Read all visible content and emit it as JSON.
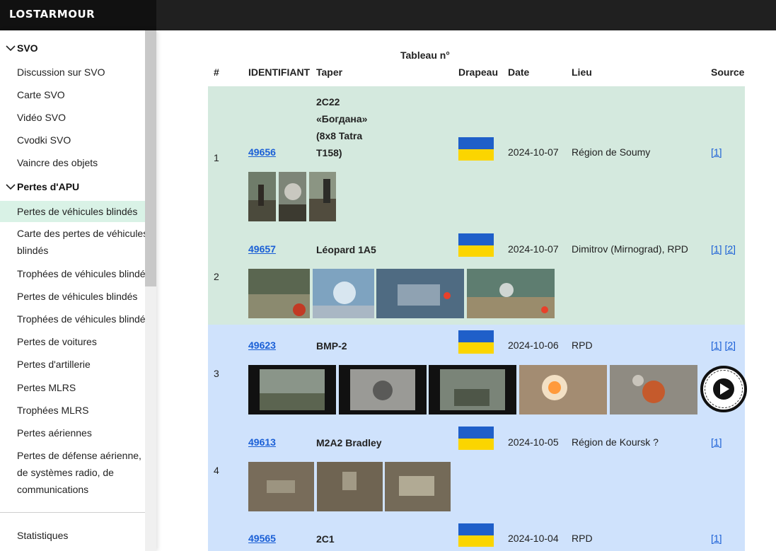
{
  "app": {
    "logo": "LOSTARMOUR"
  },
  "sidebar": {
    "groups": [
      {
        "label": "SVO"
      },
      {
        "label": "Pertes d'APU"
      }
    ],
    "svo_items": [
      {
        "label": "Discussion sur SVO"
      },
      {
        "label": "Carte SVO"
      },
      {
        "label": "Vidéo SVO"
      },
      {
        "label": "Cvodki SVO"
      },
      {
        "label": "Vaincre des objets"
      }
    ],
    "apu_items": [
      {
        "label": "Pertes de véhicules blindés",
        "active": true
      },
      {
        "label": "Carte des pertes de véhicules blindés"
      },
      {
        "label": "Trophées de véhicules blindés"
      },
      {
        "label": "Pertes de véhicules blindés"
      },
      {
        "label": "Trophées de véhicules blindés"
      },
      {
        "label": "Pertes de voitures"
      },
      {
        "label": "Pertes d'artillerie"
      },
      {
        "label": "Pertes MLRS"
      },
      {
        "label": "Trophées MLRS"
      },
      {
        "label": "Pertes aériennes"
      },
      {
        "label": "Pertes de défense aérienne, de systèmes radio, de communications"
      }
    ],
    "bottom_item": {
      "label": "Statistiques"
    }
  },
  "table": {
    "headers": {
      "num": "#",
      "id": "IDENTIFIANT",
      "type": "Taper",
      "tableau": "Tableau n°",
      "flag": "Drapeau",
      "date": "Date",
      "place": "Lieu",
      "source": "Source"
    },
    "rows": [
      {
        "num": "1",
        "id": "49656",
        "type": "2C22 «Богдана» (8x8 Tatra T158)",
        "date": "2024-10-07",
        "place": "Région de Soumy",
        "sources": [
          "[1]"
        ]
      },
      {
        "num": "2",
        "id": "49657",
        "type": "Léopard 1A5",
        "date": "2024-10-07",
        "place": "Dimitrov (Mirnograd), RPD",
        "sources": [
          "[1]",
          "[2]"
        ]
      },
      {
        "num": "3",
        "id": "49623",
        "type": "BMP-2",
        "date": "2024-10-06",
        "place": "RPD",
        "sources": [
          "[1]",
          "[2]"
        ]
      },
      {
        "num": "4",
        "id": "49613",
        "type": "M2A2 Bradley",
        "date": "2024-10-05",
        "place": "Région de Koursk ?",
        "sources": [
          "[1]"
        ]
      },
      {
        "num": "",
        "id": "49565",
        "type": "2C1",
        "date": "2024-10-04",
        "place": "RPD",
        "sources": [
          "[1]"
        ]
      }
    ]
  },
  "colors": {
    "row_green": "#d4e9de",
    "row_blue": "#cfe2fc",
    "link": "#1a5fd6",
    "flag_blue": "#1f5fc9",
    "flag_yellow": "#fbd500"
  }
}
